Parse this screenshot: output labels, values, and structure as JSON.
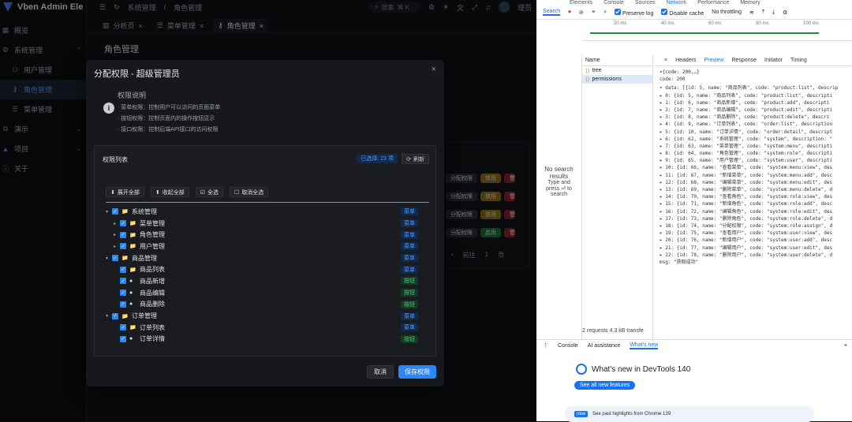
{
  "app": {
    "logo_text": "Vben Admin Ele",
    "sidebar": [
      {
        "label": "概览",
        "icon": "grid-icon"
      },
      {
        "label": "系统管理",
        "icon": "gear-icon"
      },
      {
        "label": "用户管理",
        "icon": "users-icon"
      },
      {
        "label": "角色管理",
        "icon": "key-icon",
        "active": true
      },
      {
        "label": "菜单管理",
        "icon": "menu-icon"
      },
      {
        "label": "演示",
        "icon": "demo-icon"
      },
      {
        "label": "项目",
        "icon": "project-icon"
      },
      {
        "label": "关于",
        "icon": "info-icon"
      }
    ],
    "breadcrumb": [
      "系统管理",
      "角色管理"
    ],
    "search_placeholder": "搜索",
    "search_kbd": "⌘ K",
    "username": "理员",
    "tabs": [
      "分析页",
      "菜单管理",
      "角色管理"
    ],
    "page_title": "角色管理",
    "bg_actions": [
      "分配权限",
      "禁用",
      "启用"
    ],
    "pager": {
      "prefix": "前往",
      "page": "1",
      "suffix": "页"
    }
  },
  "modal": {
    "title": "分配权限 - 超级管理员",
    "info_title": "权限说明",
    "info_lines": [
      "· 菜单权限：控制用户可以访问的页面菜单",
      "· 按钮权限：控制页面内的操作按钮显示",
      "· 接口权限：控制后端API接口的访问权限"
    ],
    "card_title": "权限列表",
    "selected": "已选择: 23 项",
    "refresh": "刷新",
    "toolbar": [
      "展开全部",
      "收起全部",
      "全选",
      "取消全选"
    ],
    "tree": [
      {
        "label": "系统管理",
        "level": 0,
        "arrow": "▾",
        "type": "菜单"
      },
      {
        "label": "菜单管理",
        "level": 1,
        "arrow": "▸",
        "type": "菜单"
      },
      {
        "label": "角色管理",
        "level": 1,
        "arrow": "▸",
        "type": "菜单"
      },
      {
        "label": "用户管理",
        "level": 1,
        "arrow": "▸",
        "type": "菜单"
      },
      {
        "label": "商品管理",
        "level": 0,
        "arrow": "▾",
        "type": "菜单"
      },
      {
        "label": "商品列表",
        "level": 1,
        "arrow": "",
        "type": "菜单"
      },
      {
        "label": "商品新增",
        "level": 1,
        "arrow": "",
        "type": "按钮"
      },
      {
        "label": "商品编辑",
        "level": 1,
        "arrow": "",
        "type": "按钮"
      },
      {
        "label": "商品删除",
        "level": 1,
        "arrow": "",
        "type": "按钮"
      },
      {
        "label": "订单管理",
        "level": 0,
        "arrow": "▾",
        "type": "菜单"
      },
      {
        "label": "订单列表",
        "level": 1,
        "arrow": "",
        "type": "菜单"
      },
      {
        "label": "订单详情",
        "level": 1,
        "arrow": "",
        "type": "按钮"
      }
    ],
    "cancel": "取消",
    "save": "保存权限"
  },
  "devtools": {
    "main_tabs": [
      "Elements",
      "Console",
      "Sources",
      "Network",
      "Performance",
      "Memory"
    ],
    "active_tab": "Network",
    "search_tab": "Search",
    "preserve_log": "Preserve log",
    "disable_cache": "Disable cache",
    "throttle": "No throttling",
    "timeline_ticks": [
      "20 ms",
      "40 ms",
      "60 ms",
      "80 ms",
      "100 ms"
    ],
    "no_results": [
      "No search",
      "results",
      "Type and",
      "press ⏎ to",
      "search"
    ],
    "name_header": "Name",
    "requests": [
      "tree",
      "permissions"
    ],
    "panel_tabs": [
      "Headers",
      "Preview",
      "Response",
      "Initiator",
      "Timing"
    ],
    "json_lines": [
      "▾{code: 200,…}",
      "  code: 200",
      "▾ data: [{id: 5, name: \"商品列表\", code: \"product:list\", descrip",
      "  ▸ 0: {id: 5, name: \"商品列表\", code: \"product:list\", descripti",
      "  ▸ 1: {id: 6, name: \"商品新增\", code: \"product:add\", descripti",
      "  ▸ 2: {id: 7, name: \"商品编辑\", code: \"product:edit\", descripti",
      "  ▸ 3: {id: 8, name: \"商品删除\", code: \"product:delete\", descri",
      "  ▸ 4: {id: 9, name: \"订单列表\", code: \"order:list\", description",
      "  ▸ 5: {id: 10, name: \"订单详情\", code: \"order:detail\", descript",
      "  ▸ 6: {id: 62, name: \"系统管理\", code: \"system\", description: \"",
      "  ▸ 7: {id: 63, name: \"菜单管理\", code: \"system:menu\", descripti",
      "  ▸ 8: {id: 64, name: \"角色管理\", code: \"system:role\", descripti",
      "  ▸ 9: {id: 65, name: \"用户管理\", code: \"system:user\", descripti",
      "  ▸ 10: {id: 66, name: \"查看菜单\", code: \"system:menu:view\", des",
      "  ▸ 11: {id: 67, name: \"新增菜单\", code: \"system:menu:add\", desc",
      "  ▸ 12: {id: 68, name: \"编辑菜单\", code: \"system:menu:edit\", des",
      "  ▸ 13: {id: 69, name: \"删除菜单\", code: \"system:menu:delete\", d",
      "  ▸ 14: {id: 70, name: \"查看角色\", code: \"system:role:view\", des",
      "  ▸ 15: {id: 71, name: \"新增角色\", code: \"system:role:add\", desc",
      "  ▸ 16: {id: 72, name: \"编辑角色\", code: \"system:role:edit\", des",
      "  ▸ 17: {id: 73, name: \"删除角色\", code: \"system:role:delete\", d",
      "  ▸ 18: {id: 74, name: \"分配权限\", code: \"system:role:assign\", d",
      "  ▸ 19: {id: 75, name: \"查看用户\", code: \"system:user:view\", des",
      "  ▸ 20: {id: 76, name: \"新增用户\", code: \"system:user:add\", desc",
      "  ▸ 21: {id: 77, name: \"编辑用户\", code: \"system:user:edit\", des",
      "  ▸ 22: {id: 78, name: \"删除用户\", code: \"system:user:delete\", d",
      "  msg: \"获取成功\""
    ],
    "status": "2 requests   4.3 kB transfe",
    "drawer_tabs": [
      "Console",
      "AI assistance",
      "What's new"
    ],
    "whats_new": "What's new in DevTools 140",
    "see_all": "See all new features",
    "highlight_badge": "new",
    "highlight_text": "See past highlights from Chrome 139"
  }
}
